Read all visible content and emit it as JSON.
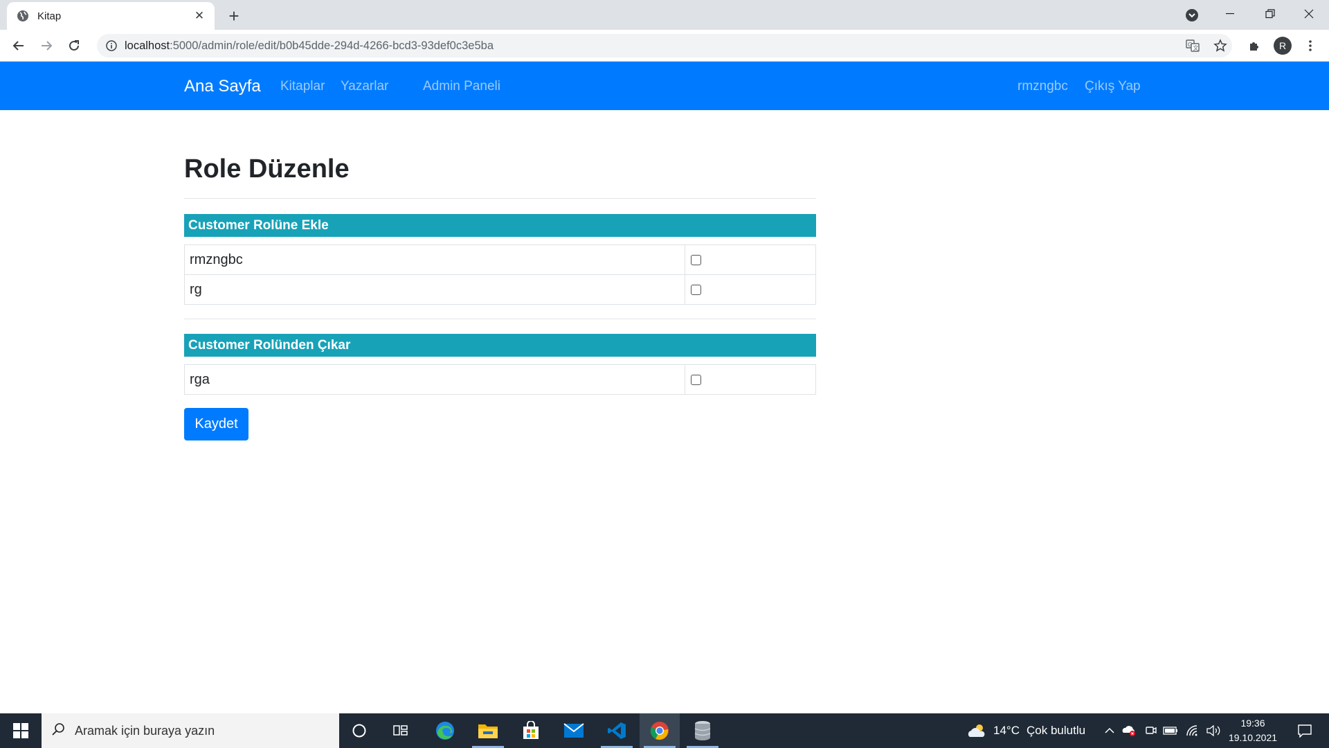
{
  "browser": {
    "tab_title": "Kitap",
    "url_host": "localhost",
    "url_rest": ":5000/admin/role/edit/b0b45dde-294d-4266-bcd3-93def0c3e5ba",
    "profile_initial": "R"
  },
  "navbar": {
    "brand": "Ana Sayfa",
    "links": [
      "Kitaplar",
      "Yazarlar",
      "Admin Paneli"
    ],
    "user": "rmzngbc",
    "logout": "Çıkış Yap"
  },
  "page": {
    "title": "Role Düzenle",
    "add_section": {
      "title": "Customer Rolüne Ekle",
      "users": [
        {
          "name": "rmzngbc",
          "checked": false
        },
        {
          "name": "rg",
          "checked": false
        }
      ]
    },
    "remove_section": {
      "title": "Customer Rolünden Çıkar",
      "users": [
        {
          "name": "rga",
          "checked": false
        }
      ]
    },
    "save_label": "Kaydet"
  },
  "colors": {
    "navbar": "#007bff",
    "section_header": "#17a2b8",
    "primary_button": "#007bff"
  },
  "taskbar": {
    "search_placeholder": "Aramak için buraya yazın",
    "weather_temp": "14°C",
    "weather_desc": "Çok bulutlu",
    "time": "19:36",
    "date": "19.10.2021"
  }
}
